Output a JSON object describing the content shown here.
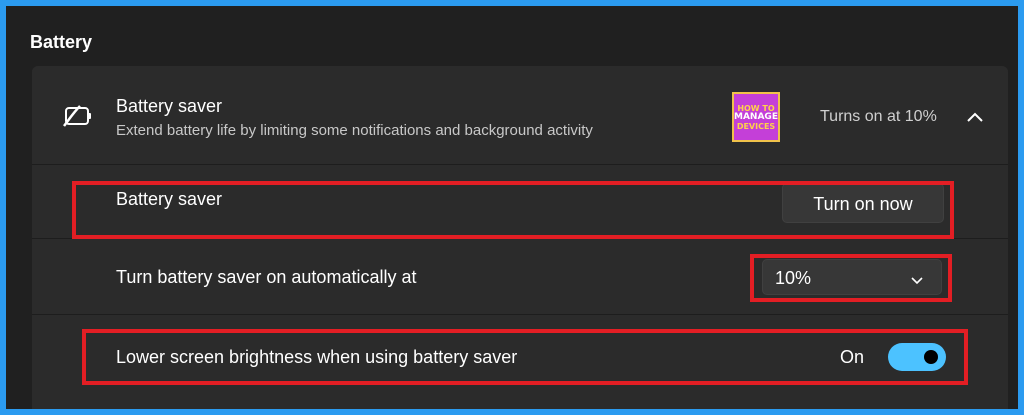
{
  "section": {
    "title": "Battery"
  },
  "battery_saver_card": {
    "icon": "battery-saver-icon",
    "title": "Battery saver",
    "description": "Extend battery life by limiting some notifications and background activity",
    "logo": {
      "line1": "HOW TO",
      "line2": "MANAGE",
      "line3": "DEVICES"
    },
    "status": "Turns on at 10%",
    "expanded": true
  },
  "rows": {
    "battery_saver": {
      "label": "Battery saver",
      "button_label": "Turn on now"
    },
    "auto_on": {
      "label": "Turn battery saver on automatically at",
      "selected": "10%"
    },
    "brightness": {
      "label": "Lower screen brightness when using battery saver",
      "toggle_text": "On",
      "toggle_on": true
    }
  },
  "colors": {
    "background": "#202020",
    "card": "#2b2b2b",
    "accent": "#4cc2ff",
    "highlight": "#e31e24",
    "frame": "#2b9bf0"
  }
}
